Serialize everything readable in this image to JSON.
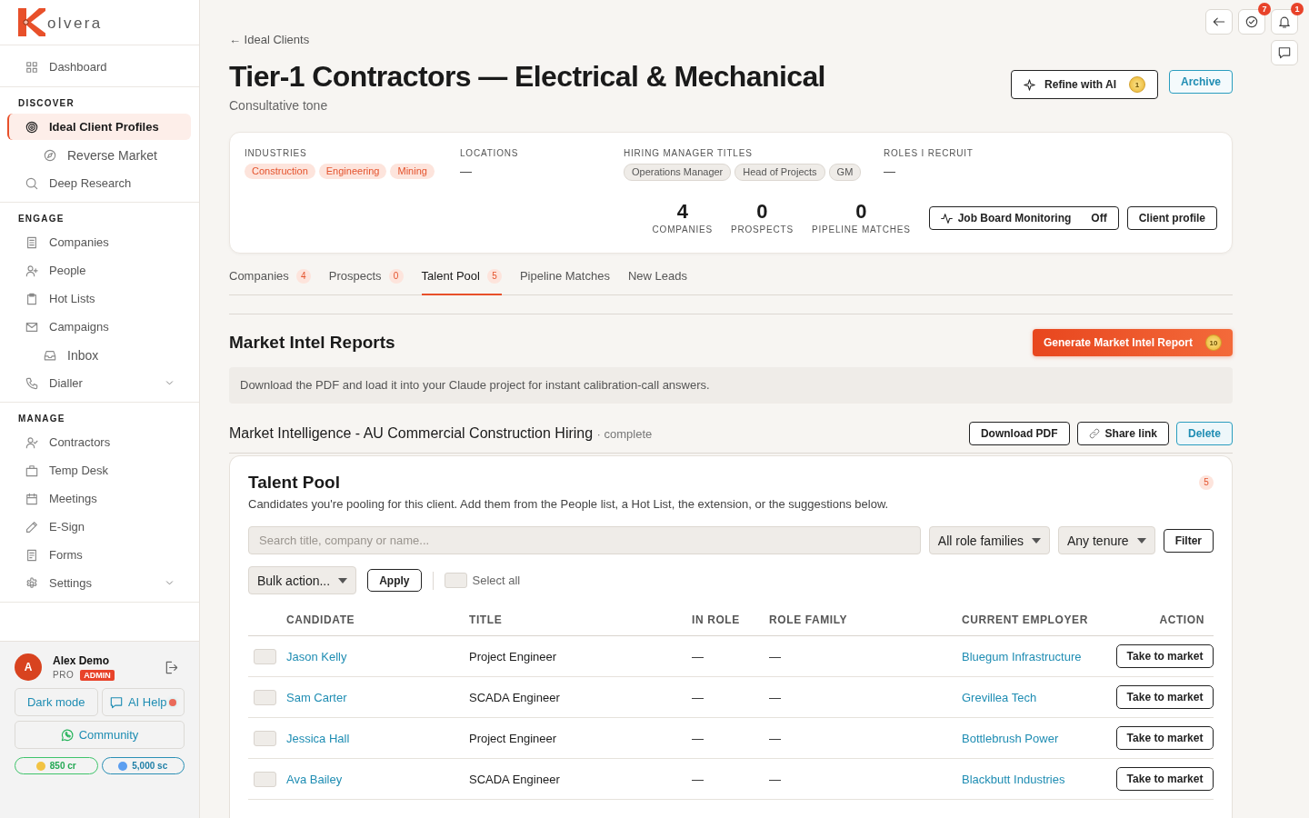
{
  "sidebar": {
    "brand": "olvera",
    "sections": [
      {
        "items": [
          {
            "label": "Dashboard",
            "selected": false
          }
        ]
      },
      {
        "heading": "DISCOVER",
        "items": [
          {
            "label": "Ideal Client Profiles",
            "selected": true,
            "children": [
              {
                "label": "Reverse Market",
                "selected": false
              }
            ]
          },
          {
            "label": "Deep Research",
            "selected": false
          }
        ]
      },
      {
        "heading": "ENGAGE",
        "items": [
          {
            "label": "Companies",
            "selected": false
          },
          {
            "label": "People",
            "selected": false
          },
          {
            "label": "Hot Lists",
            "selected": false
          },
          {
            "label": "Campaigns",
            "selected": false,
            "children": [
              {
                "label": "Inbox",
                "selected": false
              }
            ]
          },
          {
            "label": "Dialler",
            "selected": false,
            "expanded": false
          }
        ]
      },
      {
        "heading": "MANAGE",
        "items": [
          {
            "label": "Contractors",
            "selected": false
          },
          {
            "label": "Temp Desk",
            "selected": false
          },
          {
            "label": "Meetings",
            "selected": false
          },
          {
            "label": "E-Sign",
            "selected": false
          },
          {
            "label": "Forms",
            "selected": false
          },
          {
            "label": "Settings",
            "selected": false,
            "expanded": false
          }
        ]
      }
    ],
    "user": {
      "initial": "A",
      "name": "Alex Demo",
      "plan": "PRO",
      "role": "ADMIN"
    },
    "actions": [
      {
        "label": "Dark mode",
        "kind": "theme"
      },
      {
        "label": "AI Help",
        "kind": "help",
        "unread": true
      },
      {
        "label": "Community",
        "kind": "community"
      }
    ],
    "balances": [
      {
        "label": "850 cr",
        "kind": "credits",
        "color": "#f2c343"
      },
      {
        "label": "5,000 sc",
        "kind": "scans",
        "color": "#5b9ef0"
      }
    ]
  },
  "toolbar": {
    "tasks_count": "7",
    "notifications_count": "1"
  },
  "header": {
    "breadcrumb": "← Ideal Clients",
    "title": "Tier-1 Contractors — Electrical & Mechanical",
    "subtitle": "Consultative tone",
    "refine": {
      "label": "Refine with AI",
      "cost": "1"
    },
    "archive": {
      "label": "Archive"
    }
  },
  "profile": {
    "fields": [
      {
        "label": "INDUSTRIES",
        "kind": "tags",
        "tags": [
          "Construction",
          "Engineering",
          "Mining"
        ]
      },
      {
        "label": "LOCATIONS",
        "kind": "text",
        "value": "—"
      },
      {
        "label": "HIRING MANAGER TITLES",
        "kind": "chips",
        "tags": [
          "Operations Manager",
          "Head of Projects",
          "GM"
        ]
      },
      {
        "label": "ROLES I RECRUIT",
        "kind": "text",
        "value": "—"
      }
    ],
    "stats": [
      {
        "value": "4",
        "label": "COMPANIES"
      },
      {
        "value": "0",
        "label": "PROSPECTS"
      },
      {
        "value": "0",
        "label": "PIPELINE MATCHES"
      }
    ],
    "monitoring": {
      "label": "Job Board Monitoring",
      "status": "Off",
      "on": false
    },
    "client_profile": {
      "label": "Client profile"
    }
  },
  "tabs": [
    {
      "label": "Companies",
      "count": "4",
      "selected": false
    },
    {
      "label": "Prospects",
      "count": "0",
      "selected": false
    },
    {
      "label": "Talent Pool",
      "count": "5",
      "selected": true
    },
    {
      "label": "Pipeline Matches",
      "selected": false
    },
    {
      "label": "New Leads",
      "selected": false
    }
  ],
  "reports": {
    "heading": "Market Intel Reports",
    "generate": {
      "label": "Generate Market Intel Report",
      "cost": "10"
    },
    "note": "Download the PDF and load it into your Claude project for instant calibration-call answers.",
    "items": [
      {
        "title": "Market Intelligence - AU Commercial Construction Hiring",
        "status": "· complete",
        "actions": [
          {
            "label": "Download PDF",
            "kind": "download"
          },
          {
            "label": "Share link",
            "kind": "share"
          },
          {
            "label": "Delete",
            "kind": "delete"
          }
        ]
      }
    ]
  },
  "talent_pool": {
    "title": "Talent Pool",
    "count": "5",
    "description": "Candidates you're pooling for this client. Add them from the People list, a Hot List, the extension, or the suggestions below.",
    "search": {
      "placeholder": "Search title, company or name..."
    },
    "filters": [
      "All role families",
      "Any tenure"
    ],
    "filter_button": "Filter",
    "bulk_action": "Bulk action...",
    "apply": "Apply",
    "select_all": {
      "label": "Select all",
      "checked": false
    },
    "columns": [
      "CANDIDATE",
      "TITLE",
      "IN ROLE",
      "ROLE FAMILY",
      "CURRENT EMPLOYER",
      "ACTION"
    ],
    "rows": [
      {
        "checked": false,
        "candidate": "Jason Kelly",
        "title": "Project Engineer",
        "in_role": "—",
        "role_family": "—",
        "employer": "Bluegum Infrastructure",
        "action": "Take to market"
      },
      {
        "checked": false,
        "candidate": "Sam Carter",
        "title": "SCADA Engineer",
        "in_role": "—",
        "role_family": "—",
        "employer": "Grevillea Tech",
        "action": "Take to market"
      },
      {
        "checked": false,
        "candidate": "Jessica Hall",
        "title": "Project Engineer",
        "in_role": "—",
        "role_family": "—",
        "employer": "Bottlebrush Power",
        "action": "Take to market"
      },
      {
        "checked": false,
        "candidate": "Ava Bailey",
        "title": "SCADA Engineer",
        "in_role": "—",
        "role_family": "—",
        "employer": "Blackbutt Industries",
        "action": "Take to market"
      }
    ]
  }
}
